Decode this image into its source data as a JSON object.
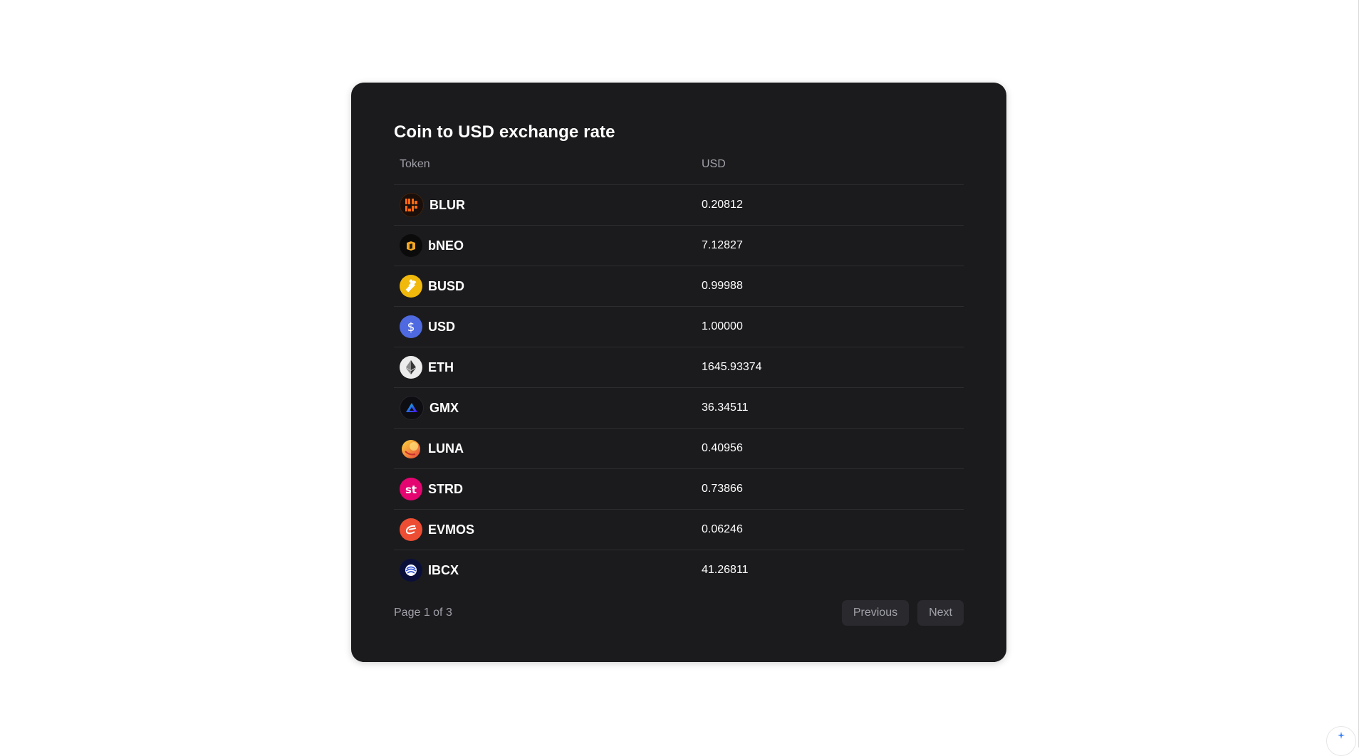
{
  "card": {
    "title": "Coin to USD exchange rate"
  },
  "table": {
    "columns": {
      "token": "Token",
      "usd": "USD"
    },
    "rows": [
      {
        "symbol": "BLUR",
        "usd": "0.20812",
        "icon": "blur-icon"
      },
      {
        "symbol": "bNEO",
        "usd": "7.12827",
        "icon": "bneo-icon"
      },
      {
        "symbol": "BUSD",
        "usd": "0.99988",
        "icon": "busd-icon"
      },
      {
        "symbol": "USD",
        "usd": "1.00000",
        "icon": "usd-icon"
      },
      {
        "symbol": "ETH",
        "usd": "1645.93374",
        "icon": "eth-icon"
      },
      {
        "symbol": "GMX",
        "usd": "36.34511",
        "icon": "gmx-icon"
      },
      {
        "symbol": "LUNA",
        "usd": "0.40956",
        "icon": "luna-icon"
      },
      {
        "symbol": "STRD",
        "usd": "0.73866",
        "icon": "strd-icon"
      },
      {
        "symbol": "EVMOS",
        "usd": "0.06246",
        "icon": "evmos-icon"
      },
      {
        "symbol": "IBCX",
        "usd": "41.26811",
        "icon": "ibcx-icon"
      }
    ]
  },
  "pagination": {
    "page_info": "Page 1 of 3",
    "previous_label": "Previous",
    "next_label": "Next"
  },
  "colors": {
    "card_background": "#1b1b1d",
    "muted_text": "#a1a1aa",
    "button_background": "#2a2a2e",
    "divider": "#2d2d31"
  }
}
